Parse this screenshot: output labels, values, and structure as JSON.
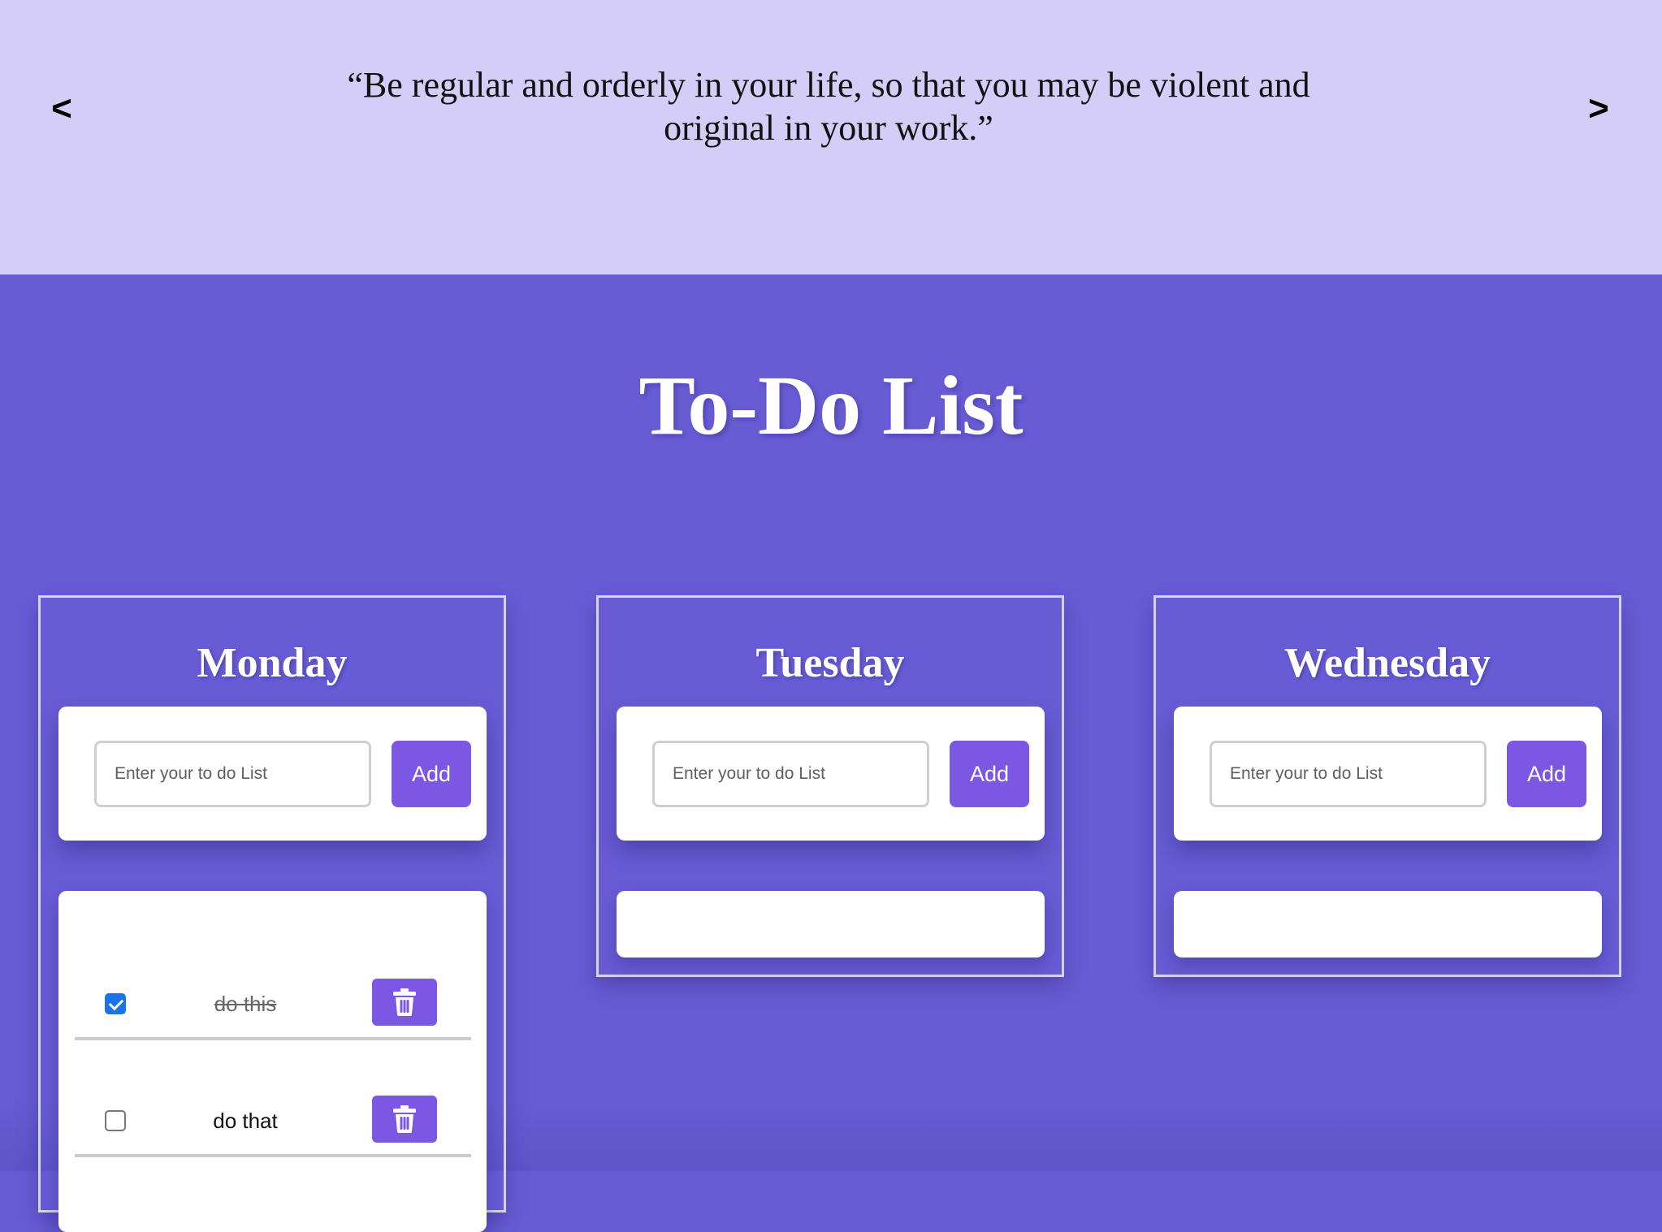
{
  "quote": {
    "text": "“Be regular and orderly in your life, so that you may be violent and original in your work.”",
    "prev_label": "<",
    "next_label": ">"
  },
  "title": "To-Do List",
  "columns": [
    {
      "day": "Monday",
      "input_placeholder": "Enter your to do List",
      "add_label": "Add",
      "items": [
        {
          "text": "do this",
          "checked": true
        },
        {
          "text": "do that",
          "checked": false
        }
      ]
    },
    {
      "day": "Tuesday",
      "input_placeholder": "Enter your to do List",
      "add_label": "Add",
      "items": []
    },
    {
      "day": "Wednesday",
      "input_placeholder": "Enter your to do List",
      "add_label": "Add",
      "items": []
    }
  ],
  "colors": {
    "quote_bg": "#d4cdf8",
    "main_bg": "#685cd5",
    "button": "#7b57e3",
    "checkbox_checked": "#1a73e8"
  },
  "icons": {
    "prev": "chevron-left-icon",
    "next": "chevron-right-icon",
    "delete": "trash-icon"
  }
}
